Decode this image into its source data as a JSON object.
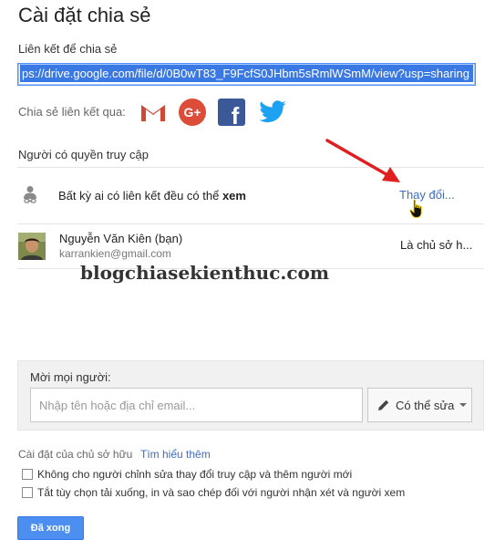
{
  "dialog": {
    "title": "Cài đặt chia sẻ"
  },
  "link": {
    "label": "Liên kết để chia sẻ",
    "url": "ps://drive.google.com/file/d/0B0wT83_F9FcfS0JHbm5sRmlWSmM/view?usp=sharing"
  },
  "share_via": {
    "label": "Chia sẻ liên kết qua:",
    "services": [
      "gmail-icon",
      "google-plus-icon",
      "facebook-icon",
      "twitter-icon"
    ],
    "google_plus_text": "G+",
    "facebook_text": "f"
  },
  "access": {
    "label": "Người có quyền truy cập",
    "link_row": {
      "text_prefix": "Bất kỳ ai có liên kết đều có thể ",
      "text_bold": "xem",
      "change_label": "Thay đổi..."
    },
    "owner_row": {
      "name": "Nguyễn Văn Kiên (bạn)",
      "email": "karrankien@gmail.com",
      "role": "Là chủ sở h..."
    }
  },
  "watermark": "blogchiasekienthuc.com",
  "invite": {
    "label": "Mời mọi người:",
    "placeholder": "Nhập tên hoặc địa chỉ email...",
    "permission_label": "Có thể sửa"
  },
  "owner_settings": {
    "label": "Cài đặt của chủ sở hữu",
    "learn_more": "Tìm hiểu thêm",
    "options": [
      "Không cho người chỉnh sửa thay đổi truy cập và thêm người mới",
      "Tắt tùy chọn tải xuống, in và sao chép đối với người nhận xét và người xem"
    ]
  },
  "footer": {
    "done_label": "Đã xong"
  },
  "colors": {
    "accent_blue": "#4d8ff0",
    "link_blue": "#3d6cc4",
    "gmail_red": "#d14836",
    "google_plus_red": "#dd4b39",
    "facebook_blue": "#3b5998",
    "twitter_blue": "#1da1f2",
    "annotation_arrow": "#e02020"
  }
}
